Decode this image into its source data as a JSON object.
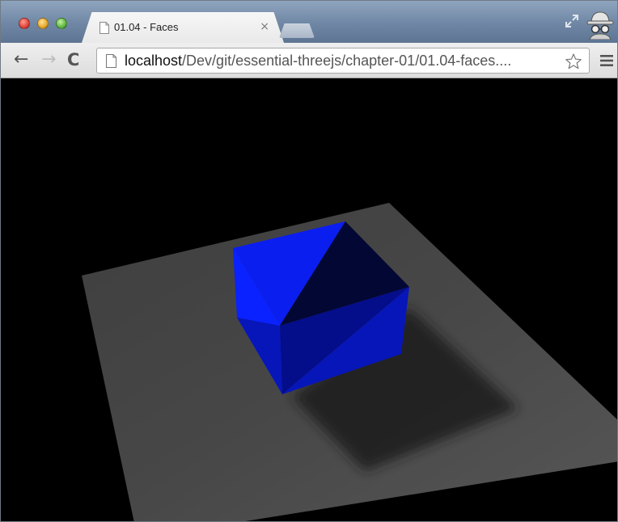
{
  "window": {
    "tab": {
      "title": "01.04 - Faces",
      "close_glyph": "×"
    },
    "icons": {
      "close": "close-button",
      "minimize": "minimize-button",
      "maximize": "maximize-button",
      "fullscreen": "fullscreen-icon",
      "incognito": "incognito-icon"
    }
  },
  "toolbar": {
    "back_glyph": "←",
    "forward_glyph": "→",
    "reload_glyph": "C",
    "url_host": "localhost",
    "url_path": "/Dev/git/essential-threejs/chapter-01/01.04-faces....",
    "star_icon": "bookmark-star-icon",
    "menu_icon": "menu-icon"
  },
  "scene": {
    "description_colors": {
      "background": "#000000",
      "plane": "#4a4a4a",
      "cube_bright": "#0a1fff",
      "cube_mid": "#0614c8",
      "cube_dark": "#030a6e",
      "cube_darkest": "#01042e",
      "shadow": "#262626"
    }
  }
}
